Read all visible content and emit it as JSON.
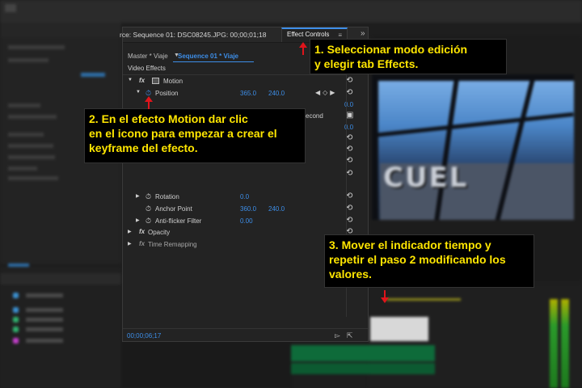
{
  "effect_controls": {
    "source_label": "rce: Sequence 01: DSC08245.JPG: 00;00;01;18",
    "tab_label": "Effect Controls",
    "tab_menu_glyph": "≡",
    "overflow_glyph": "»",
    "master_label": "Master * Viaje",
    "sequence_label": "Sequence 01 * Viaje",
    "section_title": "Video Effects",
    "timecode": "00;00;06;17",
    "rows": {
      "motion": {
        "label": "Motion"
      },
      "position": {
        "label": "Position",
        "x": "365.0",
        "y": "240.0"
      },
      "right_value_1": "0.0",
      "right_value_2": "0.0",
      "partial_label": "econd",
      "rotation": {
        "label": "Rotation",
        "value": "0.0"
      },
      "anchor_point": {
        "label": "Anchor Point",
        "x": "360.0",
        "y": "240.0"
      },
      "anti_flicker": {
        "label": "Anti-flicker Filter",
        "value": "0.00"
      },
      "opacity": {
        "label": "Opacity"
      },
      "time_remapping": {
        "label": "Time Remapping"
      }
    },
    "fx_glyph": "fx"
  },
  "callouts": {
    "step1": "1. Seleccionar modo edición\ny elegir tab Effects.",
    "step2": "2. En el efecto Motion dar clic\nen el icono para empezar a crear el\nkeyframe del efecto.",
    "step3": "3. Mover el indicador tiempo y\nrepetir el paso 2 modificando los\nvalores."
  },
  "program_video": {
    "word": "CUEL"
  },
  "colors": {
    "accent_blue": "#3d8ee8",
    "callout_text": "#ffe600",
    "arrow_red": "#e0141b"
  }
}
